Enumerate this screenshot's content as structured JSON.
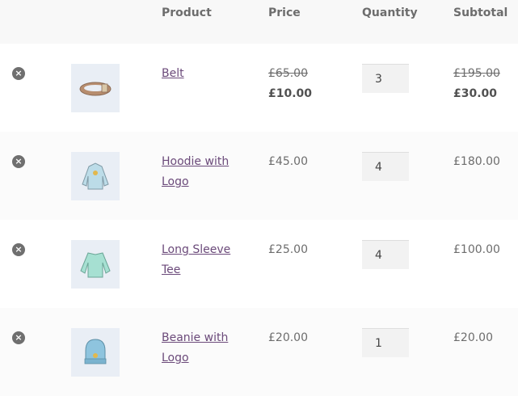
{
  "table": {
    "headers": {
      "product": "Product",
      "price": "Price",
      "quantity": "Quantity",
      "subtotal": "Subtotal"
    },
    "rows": [
      {
        "remove_label": "×",
        "image_icon": "belt-icon",
        "name": "Belt",
        "price_old": "£65.00",
        "price_new": "£10.00",
        "quantity": "3",
        "subtotal_old": "£195.00",
        "subtotal_new": "£30.00"
      },
      {
        "remove_label": "×",
        "image_icon": "hoodie-icon",
        "name": "Hoodie with Logo",
        "price": "£45.00",
        "quantity": "4",
        "subtotal": "£180.00"
      },
      {
        "remove_label": "×",
        "image_icon": "long-sleeve-tee-icon",
        "name": "Long Sleeve Tee",
        "price": "£25.00",
        "quantity": "4",
        "subtotal": "£100.00"
      },
      {
        "remove_label": "×",
        "image_icon": "beanie-icon",
        "name": "Beanie with Logo",
        "price": "£20.00",
        "quantity": "1",
        "subtotal": "£20.00"
      }
    ]
  },
  "colors": {
    "link": "#6b4a7a",
    "text": "#6d6d6d",
    "header_bg": "#f8f8f8"
  }
}
